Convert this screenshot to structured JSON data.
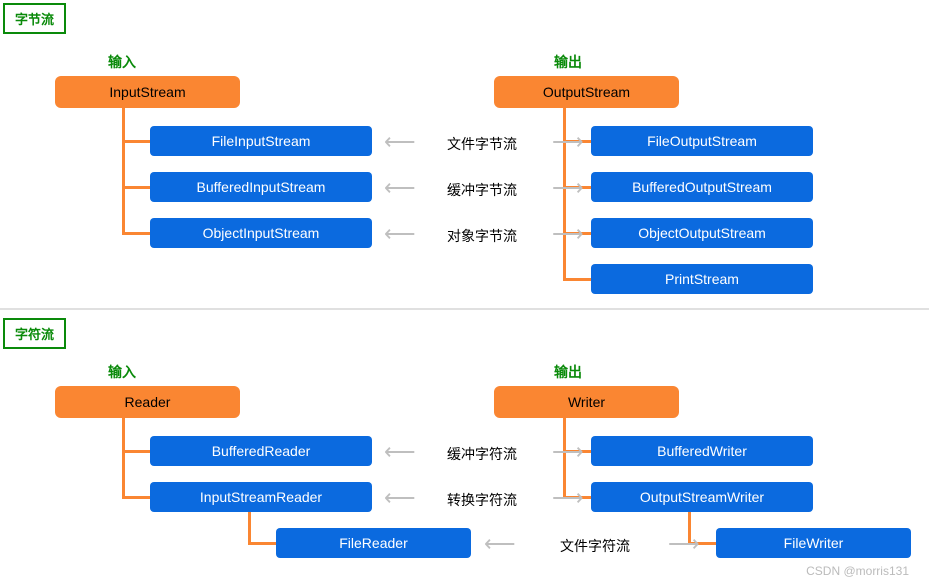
{
  "sections": {
    "byte": {
      "label": "字节流",
      "input_header": "输入",
      "output_header": "输出"
    },
    "char": {
      "label": "字符流",
      "input_header": "输入",
      "output_header": "输出"
    }
  },
  "byte_stream": {
    "input_root": "InputStream",
    "output_root": "OutputStream",
    "input_children": [
      "FileInputStream",
      "BufferedInputStream",
      "ObjectInputStream"
    ],
    "output_children": [
      "FileOutputStream",
      "BufferedOutputStream",
      "ObjectOutputStream",
      "PrintStream"
    ],
    "center_labels": [
      "文件字节流",
      "缓冲字节流",
      "对象字节流"
    ]
  },
  "char_stream": {
    "input_root": "Reader",
    "output_root": "Writer",
    "input_children": [
      "BufferedReader",
      "InputStreamReader"
    ],
    "input_grandchild": "FileReader",
    "output_children": [
      "BufferedWriter",
      "OutputStreamWriter"
    ],
    "output_grandchild": "FileWriter",
    "center_labels": [
      "缓冲字符流",
      "转换字符流",
      "文件字符流"
    ]
  },
  "footer": "CSDN @morris131"
}
